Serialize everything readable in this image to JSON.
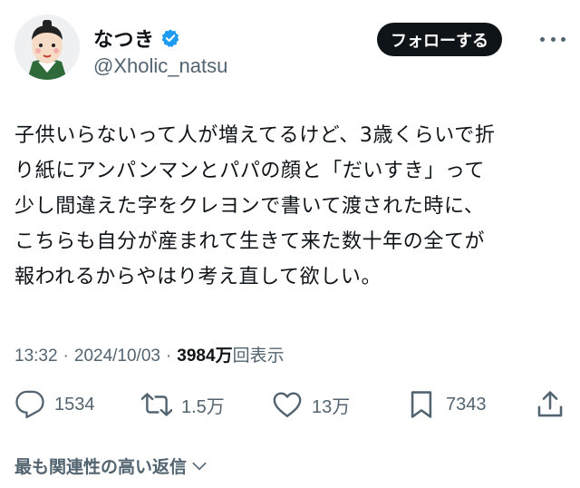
{
  "author": {
    "display_name": "なつき",
    "handle": "@Xholic_natsu"
  },
  "follow_label": "フォローする",
  "tweet": {
    "text": "子供いらないって人が増えてるけど、3歳くらいで折\nり紙にアンパンマンとパパの顔と「だいすき」って\n少し間違えた字をクレヨンで書いて渡された時に、\nこちらも自分が産まれて生きて来た数十年の全てが\n報われるからやはり考え直して欲しい。",
    "time": "13:32",
    "date": "2024/10/03",
    "separator": "·",
    "views": "3984万",
    "views_label": "回表示"
  },
  "actions": {
    "replies": "1534",
    "reposts": "1.5万",
    "likes": "13万",
    "bookmarks": "7343"
  },
  "related_label": "最も関連性の高い返信",
  "colors": {
    "verified": "#1d9bf0",
    "text": "#0f1419",
    "muted": "#536471",
    "button_bg": "#0f1419"
  },
  "icons": [
    "avatar-illustration",
    "verified-badge-icon",
    "more-icon",
    "reply-icon",
    "repost-icon",
    "like-icon",
    "bookmark-icon",
    "share-icon",
    "chevron-down-icon"
  ]
}
